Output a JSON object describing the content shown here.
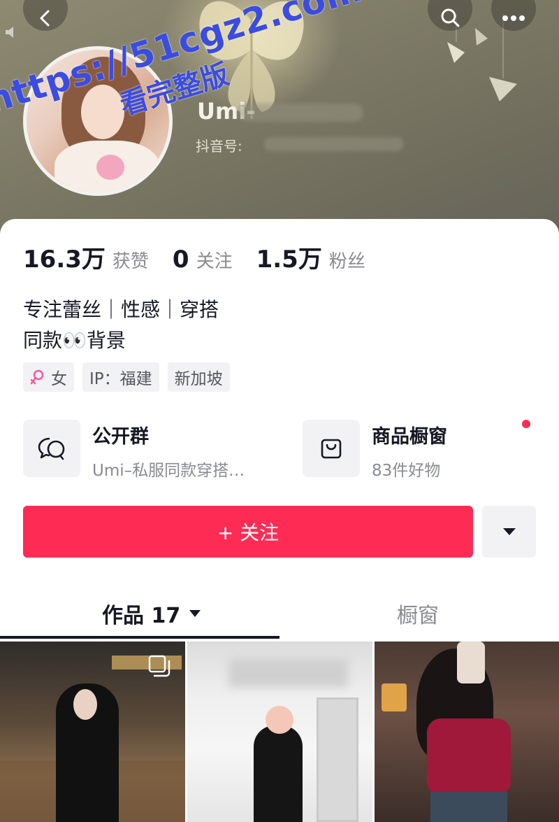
{
  "header": {
    "nickname": "Umi-",
    "douyin_id_label": "抖音号:",
    "watermark_url": "https://51cgz2.com",
    "watermark_tag": "看完整版"
  },
  "stats": [
    {
      "value": "16.3万",
      "label": "获赞"
    },
    {
      "value": "0",
      "label": "关注"
    },
    {
      "value": "1.5万",
      "label": "粉丝"
    }
  ],
  "bio": {
    "line1": "专注蕾丝｜性感｜穿搭",
    "line2": "同款👀背景"
  },
  "tags": {
    "gender": "女",
    "ip": "IP：福建",
    "location": "新加坡"
  },
  "features": {
    "group": {
      "title": "公开群",
      "subtitle": "Umi–私服同款穿搭…"
    },
    "shop": {
      "title": "商品橱窗",
      "subtitle": "83件好物"
    }
  },
  "actions": {
    "follow_label": "+ 关注"
  },
  "tabs": {
    "works_label": "作品 17",
    "window_label": "橱窗"
  },
  "colors": {
    "accent": "#fe2c55",
    "watermark": "#3b4ce0",
    "text_primary": "#161823",
    "text_secondary": "#8a8b91"
  },
  "icons": {
    "back": "chevron-left-icon",
    "search": "search-icon",
    "more": "more-horizontal-icon",
    "mute": "speaker-icon",
    "gender": "female-icon",
    "group": "chat-bubbles-icon",
    "shop": "shopping-bag-icon",
    "dropdown": "caret-down-icon",
    "multi": "multi-image-icon"
  }
}
